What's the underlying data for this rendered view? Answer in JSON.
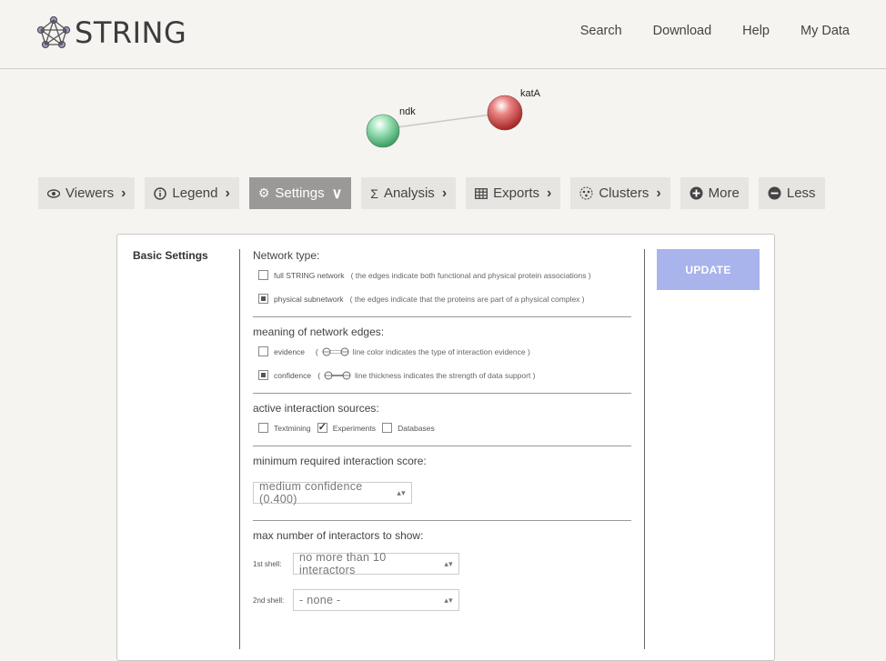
{
  "app": {
    "logo_text": "STRING"
  },
  "nav": [
    "Search",
    "Download",
    "Help",
    "My Data"
  ],
  "network": {
    "nodes": [
      {
        "label": "ndk",
        "color": "#5fc48a"
      },
      {
        "label": "katA",
        "color": "#d94a4a"
      }
    ]
  },
  "toolbar": [
    {
      "label": "Viewers",
      "icon": "eye-icon",
      "chevron": ">"
    },
    {
      "label": "Legend",
      "icon": "info-icon",
      "chevron": ">"
    },
    {
      "label": "Settings",
      "icon": "gear-icon",
      "chevron": "v",
      "active": true
    },
    {
      "label": "Analysis",
      "icon": "sigma-icon",
      "chevron": ">"
    },
    {
      "label": "Exports",
      "icon": "table-icon",
      "chevron": ">"
    },
    {
      "label": "Clusters",
      "icon": "clusters-icon",
      "chevron": ">"
    },
    {
      "label": "More",
      "icon": "plus-circle-icon"
    },
    {
      "label": "Less",
      "icon": "minus-circle-icon"
    }
  ],
  "settings": {
    "section_label": "Basic Settings",
    "network_type": {
      "title": "Network type:",
      "options": [
        {
          "label": "full STRING network",
          "note": "( the edges indicate both functional and physical protein associations )",
          "selected": false
        },
        {
          "label": "physical subnetwork",
          "note": "( the edges indicate that the proteins are part of a physical complex )",
          "selected": true
        }
      ]
    },
    "edges": {
      "title": "meaning of network edges:",
      "options": [
        {
          "label": "evidence",
          "note": "line color indicates the type of interaction evidence )",
          "selected": false
        },
        {
          "label": "confidence",
          "note": "line thickness indicates the strength of data support )",
          "selected": true
        }
      ]
    },
    "sources": {
      "title": "active interaction sources:",
      "options": [
        {
          "label": "Textmining",
          "checked": false
        },
        {
          "label": "Experiments",
          "checked": true
        },
        {
          "label": "Databases",
          "checked": false
        }
      ]
    },
    "score": {
      "title": "minimum required interaction score:",
      "value": "medium confidence (0.400)"
    },
    "interactors": {
      "title": "max number of interactors to show:",
      "first_label": "1st shell:",
      "first_value": "no more than 10 interactors",
      "second_label": "2nd shell:",
      "second_value": "- none -"
    },
    "update_label": "UPDATE"
  },
  "colors": {
    "accent": "#a9b3ec",
    "active_tab": "#9a9997"
  }
}
